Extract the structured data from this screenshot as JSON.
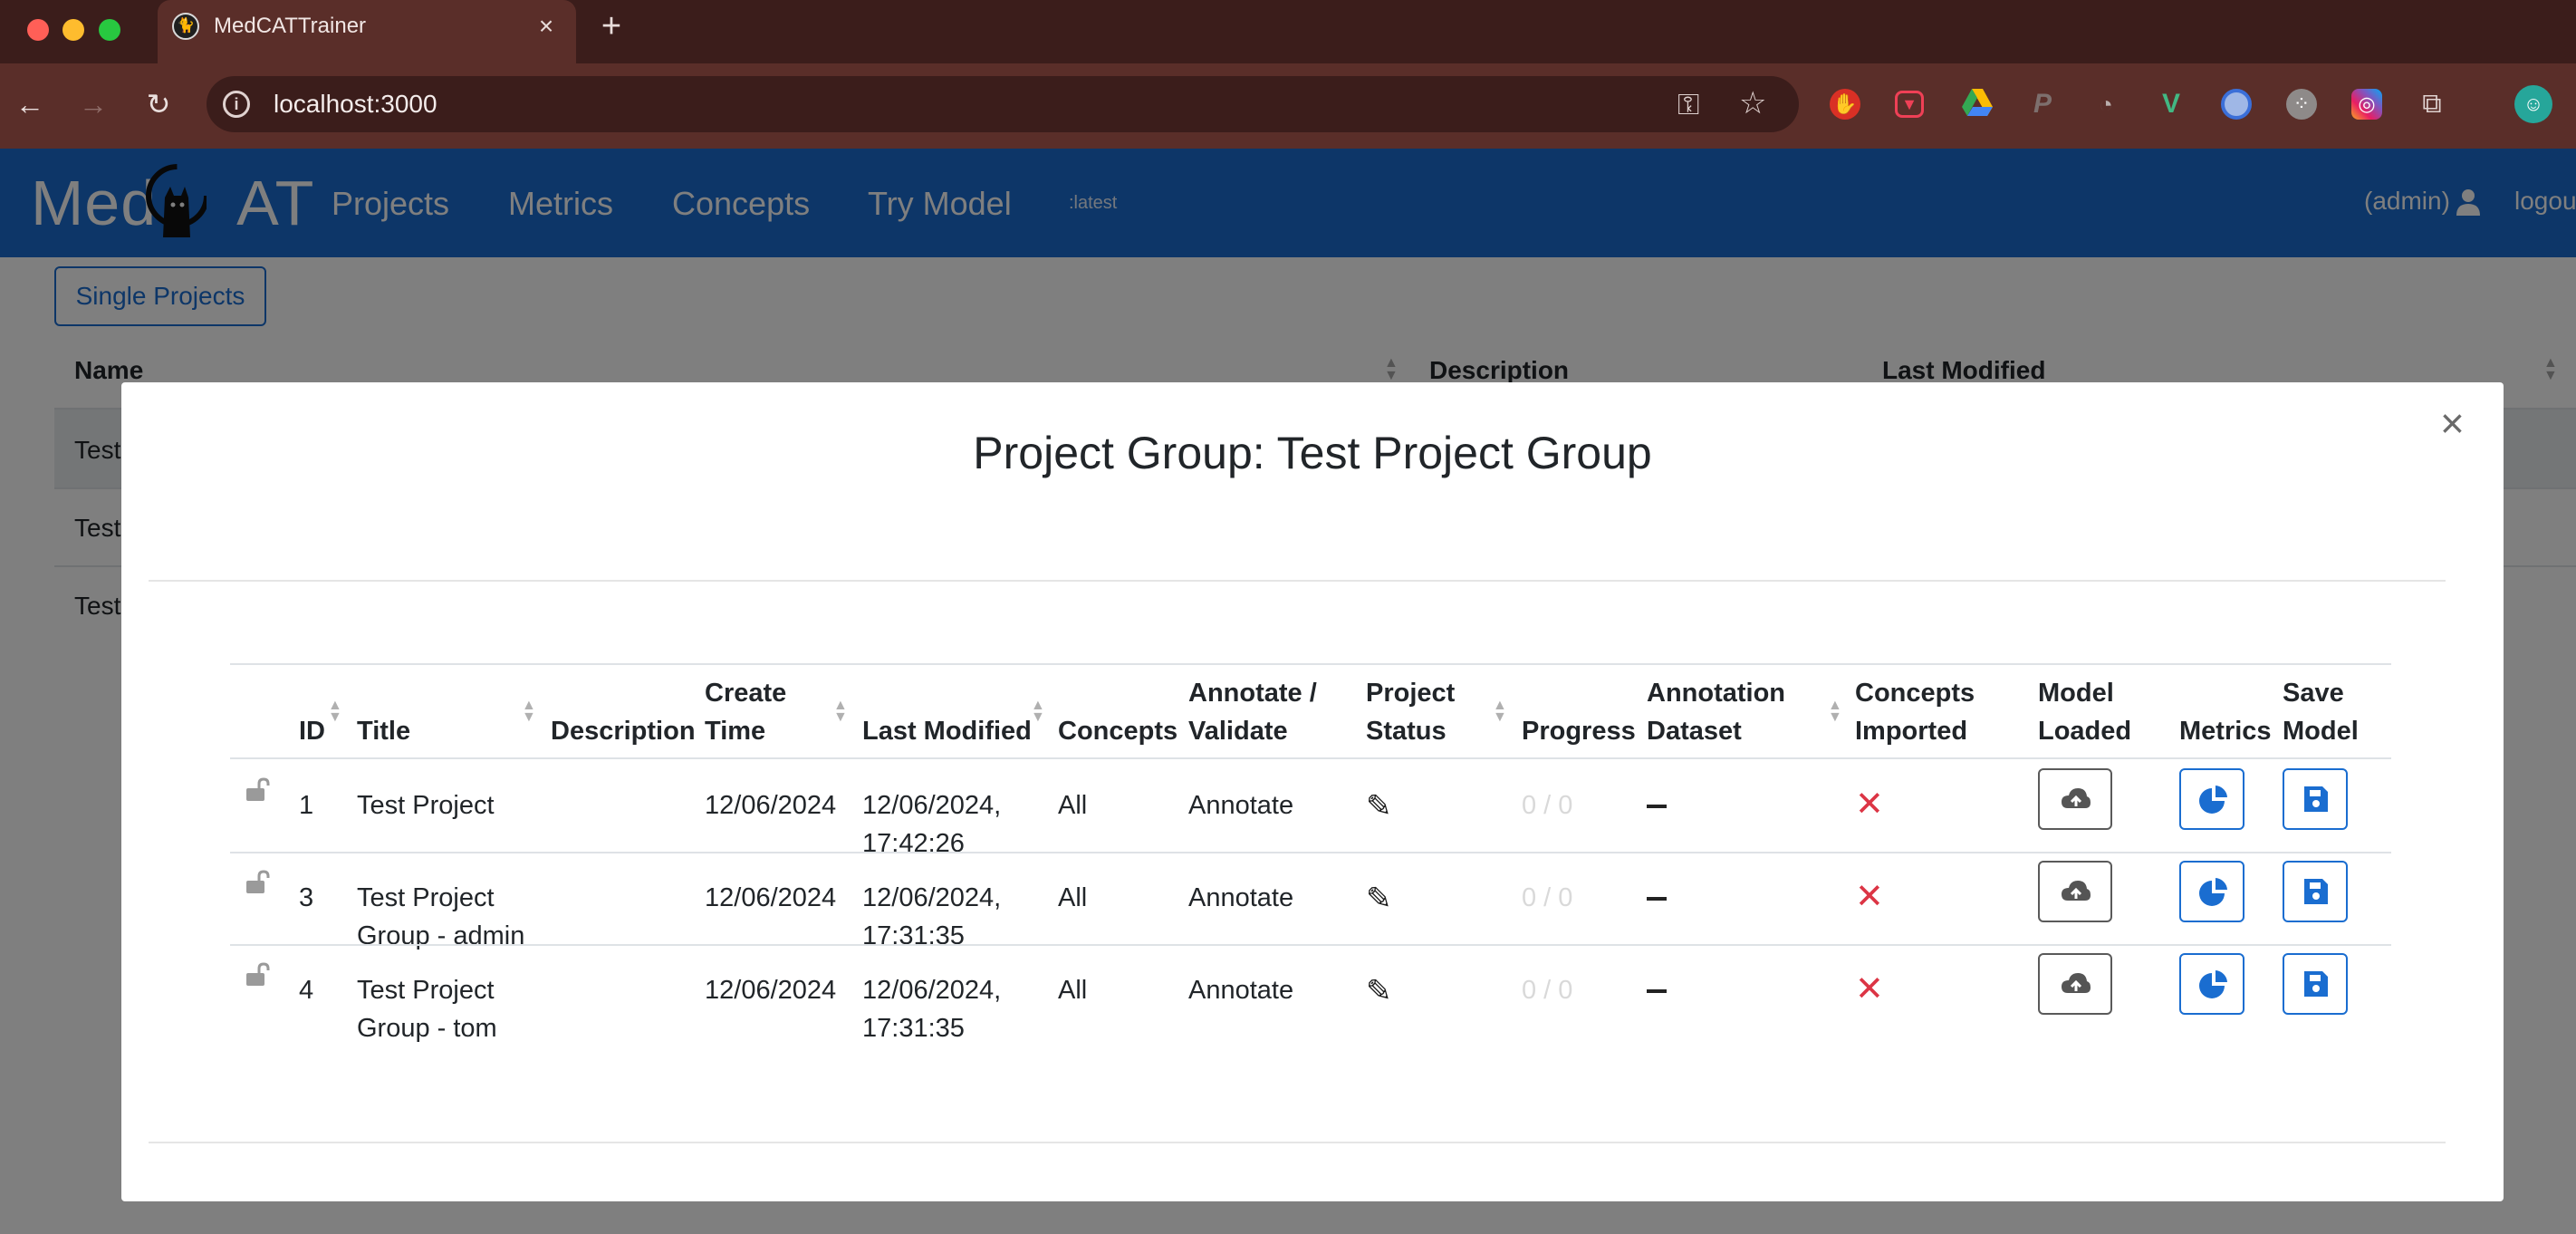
{
  "browser": {
    "tab_title": "MedCATTrainer",
    "url": "localhost:3000"
  },
  "app": {
    "logo_left": "Med",
    "logo_right": "AT",
    "nav": [
      "Projects",
      "Metrics",
      "Concepts",
      "Try Model"
    ],
    "version_tag": ":latest",
    "user": "(admin)",
    "logout": "logou"
  },
  "background": {
    "single_projects_button": "Single Projects",
    "headers": [
      "Name",
      "Description",
      "Last Modified"
    ],
    "rows": [
      "Test",
      "Test",
      "Test"
    ]
  },
  "modal": {
    "title": "Project Group: Test Project Group",
    "close": "×",
    "headers": {
      "id": "ID",
      "title": "Title",
      "description": "Description",
      "create_time_1": "Create",
      "create_time_2": "Time",
      "last_modified": "Last Modified",
      "concepts": "Concepts",
      "annotate_1": "Annotate /",
      "annotate_2": "Validate",
      "status_1": "Project",
      "status_2": "Status",
      "progress": "Progress",
      "dataset_1": "Annotation",
      "dataset_2": "Dataset",
      "imported_1": "Concepts",
      "imported_2": "Imported",
      "loaded_1": "Model",
      "loaded_2": "Loaded",
      "metrics": "Metrics",
      "save_1": "Save",
      "save_2": "Model"
    },
    "rows": [
      {
        "id": "1",
        "title_1": "Test Project",
        "title_2": "",
        "create_time": "12/06/2024",
        "modified_1": "12/06/2024,",
        "modified_2": "17:42:26",
        "concepts": "All",
        "mode": "Annotate",
        "progress": "0 / 0",
        "dataset": "—"
      },
      {
        "id": "3",
        "title_1": "Test Project",
        "title_2": "Group - admin",
        "create_time": "12/06/2024",
        "modified_1": "12/06/2024,",
        "modified_2": "17:31:35",
        "concepts": "All",
        "mode": "Annotate",
        "progress": "0 / 0",
        "dataset": "—"
      },
      {
        "id": "4",
        "title_1": "Test Project",
        "title_2": "Group - tom",
        "create_time": "12/06/2024",
        "modified_1": "12/06/2024,",
        "modified_2": "17:31:35",
        "concepts": "All",
        "mode": "Annotate",
        "progress": "0 / 0",
        "dataset": "—"
      }
    ]
  },
  "colors": {
    "primary": "#1a6dd0",
    "danger": "#dc3545",
    "chrome": "#5a2e29"
  }
}
